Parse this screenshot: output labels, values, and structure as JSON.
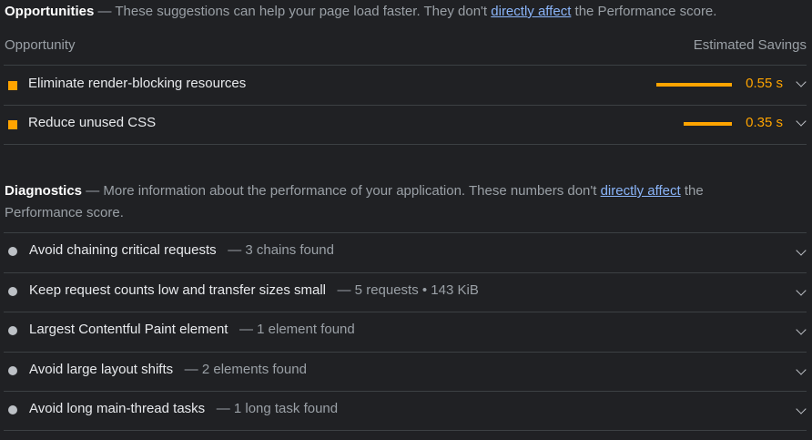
{
  "opportunities": {
    "title": "Opportunities",
    "desc_pre": " — These suggestions can help your page load faster. They don't ",
    "link": "directly affect",
    "desc_post": " the Performance score.",
    "col_left": "Opportunity",
    "col_right": "Estimated Savings",
    "accent": "#ffa400",
    "items": [
      {
        "label": "Eliminate render-blocking resources",
        "value": "0.55 s",
        "seconds": 0.55
      },
      {
        "label": "Reduce unused CSS",
        "value": "0.35 s",
        "seconds": 0.35
      }
    ]
  },
  "diagnostics": {
    "title": "Diagnostics",
    "desc_pre": " — More information about the performance of your application. These numbers don't ",
    "link": "directly affect",
    "desc_post1": " the",
    "desc_post2": "Performance score.",
    "items": [
      {
        "label": "Avoid chaining critical requests",
        "detail": "— 3 chains found"
      },
      {
        "label": "Keep request counts low and transfer sizes small",
        "detail": "— 5 requests • 143 KiB"
      },
      {
        "label": "Largest Contentful Paint element",
        "detail": "— 1 element found"
      },
      {
        "label": "Avoid large layout shifts",
        "detail": "— 2 elements found"
      },
      {
        "label": "Avoid long main-thread tasks",
        "detail": "— 1 long task found"
      }
    ]
  },
  "icons": {
    "opportunity_marker": "orange-square-icon",
    "diagnostic_marker": "gray-circle-icon",
    "expand": "chevron-down-icon"
  }
}
